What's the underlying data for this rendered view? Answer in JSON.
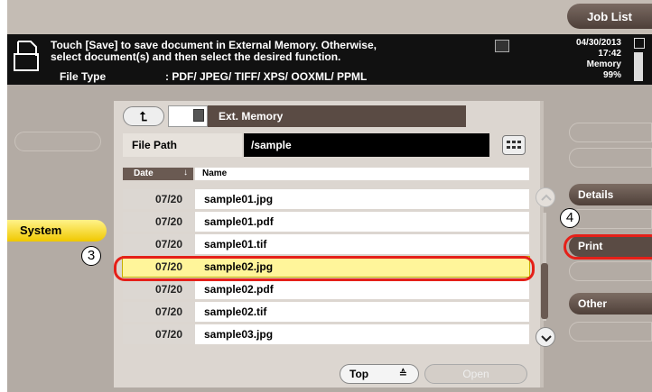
{
  "header": {
    "job_list": "Job List",
    "message_line1": "Touch [Save] to save document in External Memory. Otherwise,",
    "message_line2": "select document(s) and then select the desired function.",
    "file_type_label": "File Type",
    "file_type_value": ": PDF/ JPEG/ TIFF/ XPS/ OOXML/ PPML",
    "date": "04/30/2013",
    "time": "17:42",
    "memory_label": "Memory",
    "memory_value": "99%"
  },
  "sidebar_left": {
    "system_label": "System"
  },
  "browser": {
    "location": "Ext. Memory",
    "file_path_label": "File Path",
    "file_path_value": "/sample",
    "col_date": "Date",
    "col_name": "Name",
    "files": [
      {
        "date": "07/20",
        "name": "sample01.jpg"
      },
      {
        "date": "07/20",
        "name": "sample01.pdf"
      },
      {
        "date": "07/20",
        "name": "sample01.tif"
      },
      {
        "date": "07/20",
        "name": "sample02.jpg"
      },
      {
        "date": "07/20",
        "name": "sample02.pdf"
      },
      {
        "date": "07/20",
        "name": "sample02.tif"
      },
      {
        "date": "07/20",
        "name": "sample03.jpg"
      }
    ],
    "selected_index": 3,
    "top_button": "Top",
    "open_button": "Open"
  },
  "sidebar_right": {
    "details": "Details",
    "print": "Print",
    "other": "Other"
  },
  "annotations": {
    "step3": "3",
    "step4": "4"
  },
  "colors": {
    "highlight_red": "#e52019",
    "selected_row": "#fff59a",
    "system_yellow": "#f0c800"
  }
}
